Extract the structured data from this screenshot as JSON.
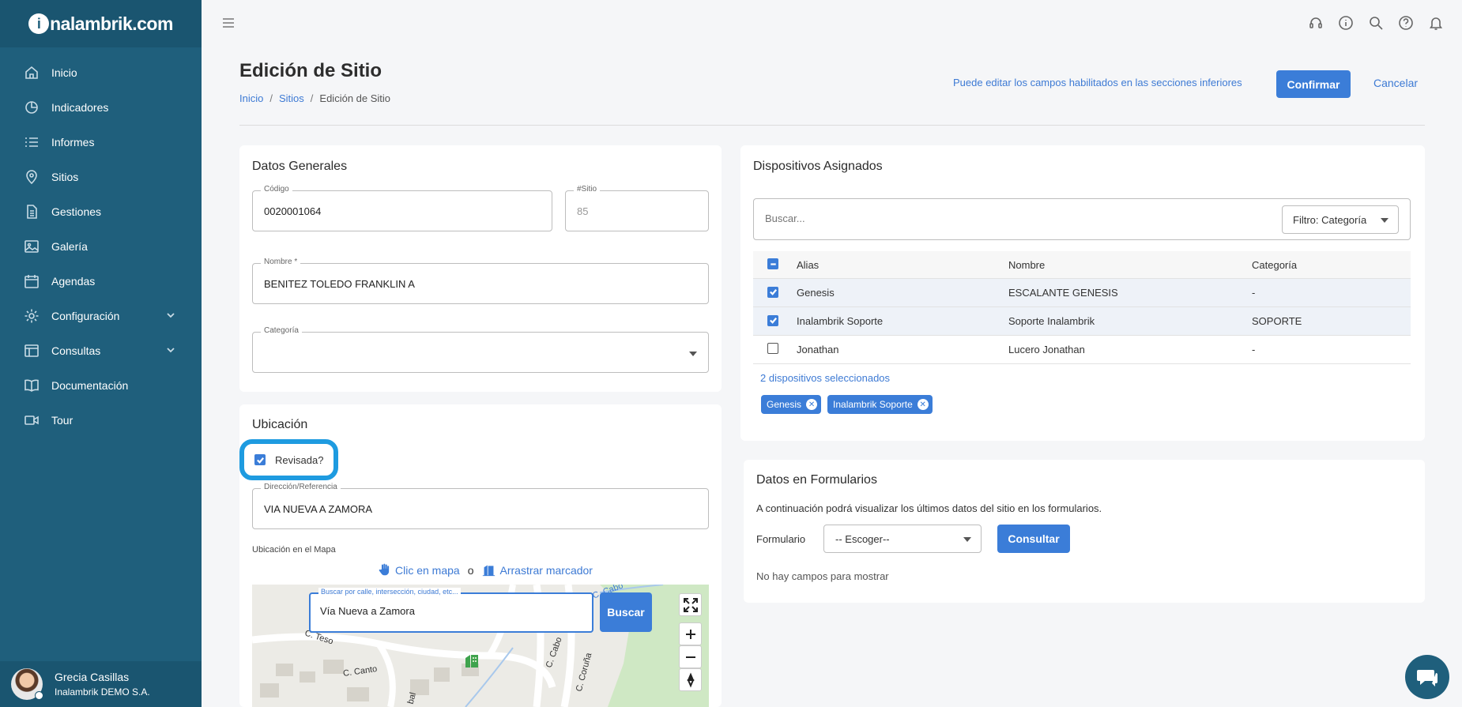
{
  "brand": {
    "name": "nalambrik.com",
    "logo_letter": "i"
  },
  "sidebar": {
    "items": [
      {
        "label": "Inicio",
        "icon": "home-icon"
      },
      {
        "label": "Indicadores",
        "icon": "pie-chart-icon"
      },
      {
        "label": "Informes",
        "icon": "list-icon"
      },
      {
        "label": "Sitios",
        "icon": "location-pin-icon"
      },
      {
        "label": "Gestiones",
        "icon": "document-icon"
      },
      {
        "label": "Galería",
        "icon": "image-icon"
      },
      {
        "label": "Agendas",
        "icon": "calendar-icon"
      },
      {
        "label": "Configuración",
        "icon": "gear-icon"
      },
      {
        "label": "Consultas",
        "icon": "table-icon"
      },
      {
        "label": "Documentación",
        "icon": "book-icon"
      },
      {
        "label": "Tour",
        "icon": "video-icon"
      }
    ],
    "user": {
      "name": "Grecia Casillas",
      "org": "Inalambrik DEMO S.A."
    }
  },
  "header": {
    "title": "Edición de Sitio",
    "breadcrumb": [
      "Inicio",
      "Sitios",
      "Edición de Sitio"
    ],
    "hint": "Puede editar los campos habilitados en las secciones inferiores",
    "confirm_label": "Confirmar",
    "cancel_label": "Cancelar"
  },
  "general": {
    "title": "Datos Generales",
    "codigo_label": "Código",
    "codigo_value": "0020001064",
    "sitio_label": "#Sitio",
    "sitio_value": "85",
    "nombre_label": "Nombre *",
    "nombre_value": "BENITEZ TOLEDO FRANKLIN A",
    "categoria_label": "Categoría",
    "categoria_value": ""
  },
  "ubicacion": {
    "title": "Ubicación",
    "revisada_label": "Revisada?",
    "revisada_checked": true,
    "direccion_label": "Dirección/Referencia",
    "direccion_value": "VIA NUEVA A ZAMORA",
    "map_label": "Ubicación en el Mapa",
    "mode_click": "Clic en mapa",
    "mode_or": "o",
    "mode_drag": "Arrastrar marcador",
    "search_label": "Buscar por calle, intersección, ciudad, etc...",
    "search_value": "Vía Nueva a Zamora",
    "search_button": "Buscar",
    "streets": [
      "C. Teso",
      "C. Canto",
      "C. Cabo",
      "C. Coruña",
      "bal",
      "C. Cabo"
    ]
  },
  "dispositivos": {
    "title": "Dispositivos Asignados",
    "search_placeholder": "Buscar...",
    "filter_label": "Filtro: Categoría",
    "columns": [
      "Alias",
      "Nombre",
      "Categoría"
    ],
    "rows": [
      {
        "alias": "Genesis",
        "nombre": "ESCALANTE GENESIS",
        "categoria": "-",
        "checked": true
      },
      {
        "alias": "Inalambrik Soporte",
        "nombre": "Soporte Inalambrik",
        "categoria": "SOPORTE",
        "checked": true
      },
      {
        "alias": "Jonathan",
        "nombre": "Lucero Jonathan",
        "categoria": "-",
        "checked": false
      }
    ],
    "selected_count": "2 dispositivos seleccionados",
    "chips": [
      "Genesis",
      "Inalambrik Soporte"
    ]
  },
  "formularios": {
    "title": "Datos en Formularios",
    "description": "A continuación podrá visualizar los últimos datos del sitio en los formularios.",
    "form_label": "Formulario",
    "form_select": "-- Escoger--",
    "consult_button": "Consultar",
    "empty_message": "No hay campos para mostrar"
  },
  "colors": {
    "sidebar": "#1f5f7c",
    "accent": "#3b7dd8",
    "highlight": "#1e9be0"
  }
}
